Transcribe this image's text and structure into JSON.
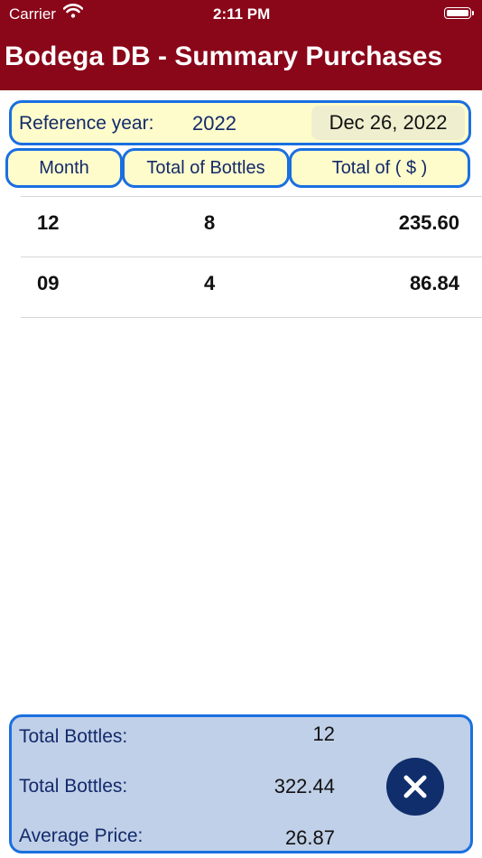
{
  "status_bar": {
    "carrier": "Carrier",
    "time": "2:11 PM"
  },
  "app": {
    "title": "Bodega DB - Summary Purchases"
  },
  "reference": {
    "label": "Reference year:",
    "year": "2022",
    "date": "Dec 26, 2022"
  },
  "columns": {
    "month": "Month",
    "bottles": "Total of Bottles",
    "total": "Total of ( $ )"
  },
  "rows": [
    {
      "month": "12",
      "bottles": "8",
      "total": "235.60"
    },
    {
      "month": "09",
      "bottles": "4",
      "total": "86.84"
    }
  ],
  "summary": {
    "bottles_label": "Total Bottles:",
    "bottles_value": "12",
    "amount_label": "Total Bottles:",
    "amount_value": "322.44",
    "avg_label": "Average Price:",
    "avg_value": "26.87"
  },
  "colors": {
    "header": "#8a0619",
    "accent": "#1a6fe0",
    "panel": "#fffccc",
    "summary": "#c0d0e8",
    "close_button": "#102e6c"
  },
  "icons": {
    "wifi": "wifi-icon",
    "battery": "battery-icon",
    "close": "close-icon"
  }
}
